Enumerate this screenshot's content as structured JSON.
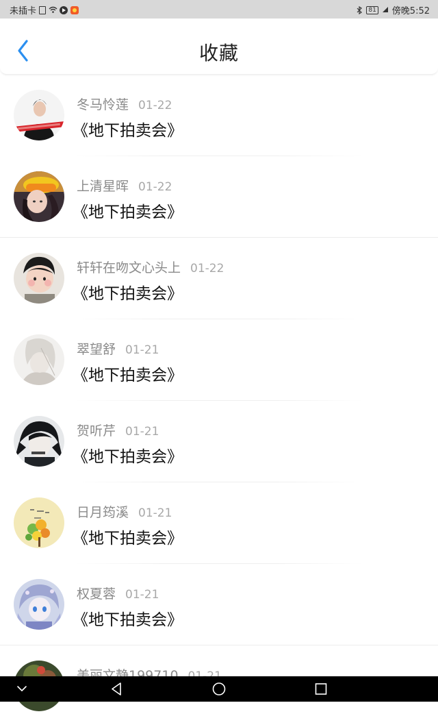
{
  "status_bar": {
    "carrier": "未插卡",
    "battery": "81",
    "time": "傍晚5:52"
  },
  "header": {
    "title": "收藏"
  },
  "items": [
    {
      "user": "冬马怜莲",
      "date": "01-22",
      "title": "《地下拍卖会》"
    },
    {
      "user": "上清星晖",
      "date": "01-22",
      "title": "《地下拍卖会》"
    },
    {
      "user": "轩轩在吻文心头上",
      "date": "01-22",
      "title": "《地下拍卖会》"
    },
    {
      "user": "翠望舒",
      "date": "01-21",
      "title": "《地下拍卖会》"
    },
    {
      "user": "贺听芹",
      "date": "01-21",
      "title": "《地下拍卖会》"
    },
    {
      "user": "日月筠溪",
      "date": "01-21",
      "title": "《地下拍卖会》"
    },
    {
      "user": "权夏蓉",
      "date": "01-21",
      "title": "《地下拍卖会》"
    },
    {
      "user": "美丽文静199710",
      "date": "01-21",
      "title": ""
    }
  ],
  "colors": {
    "accent": "#2b8ff0",
    "username": "#8a8a8a",
    "date": "#a8a8a8"
  },
  "icons": {
    "back": "chevron-left-icon",
    "nav_back": "triangle-back-icon",
    "nav_home": "circle-home-icon",
    "nav_recent": "square-recent-icon",
    "nav_hide": "chevron-down-icon"
  }
}
